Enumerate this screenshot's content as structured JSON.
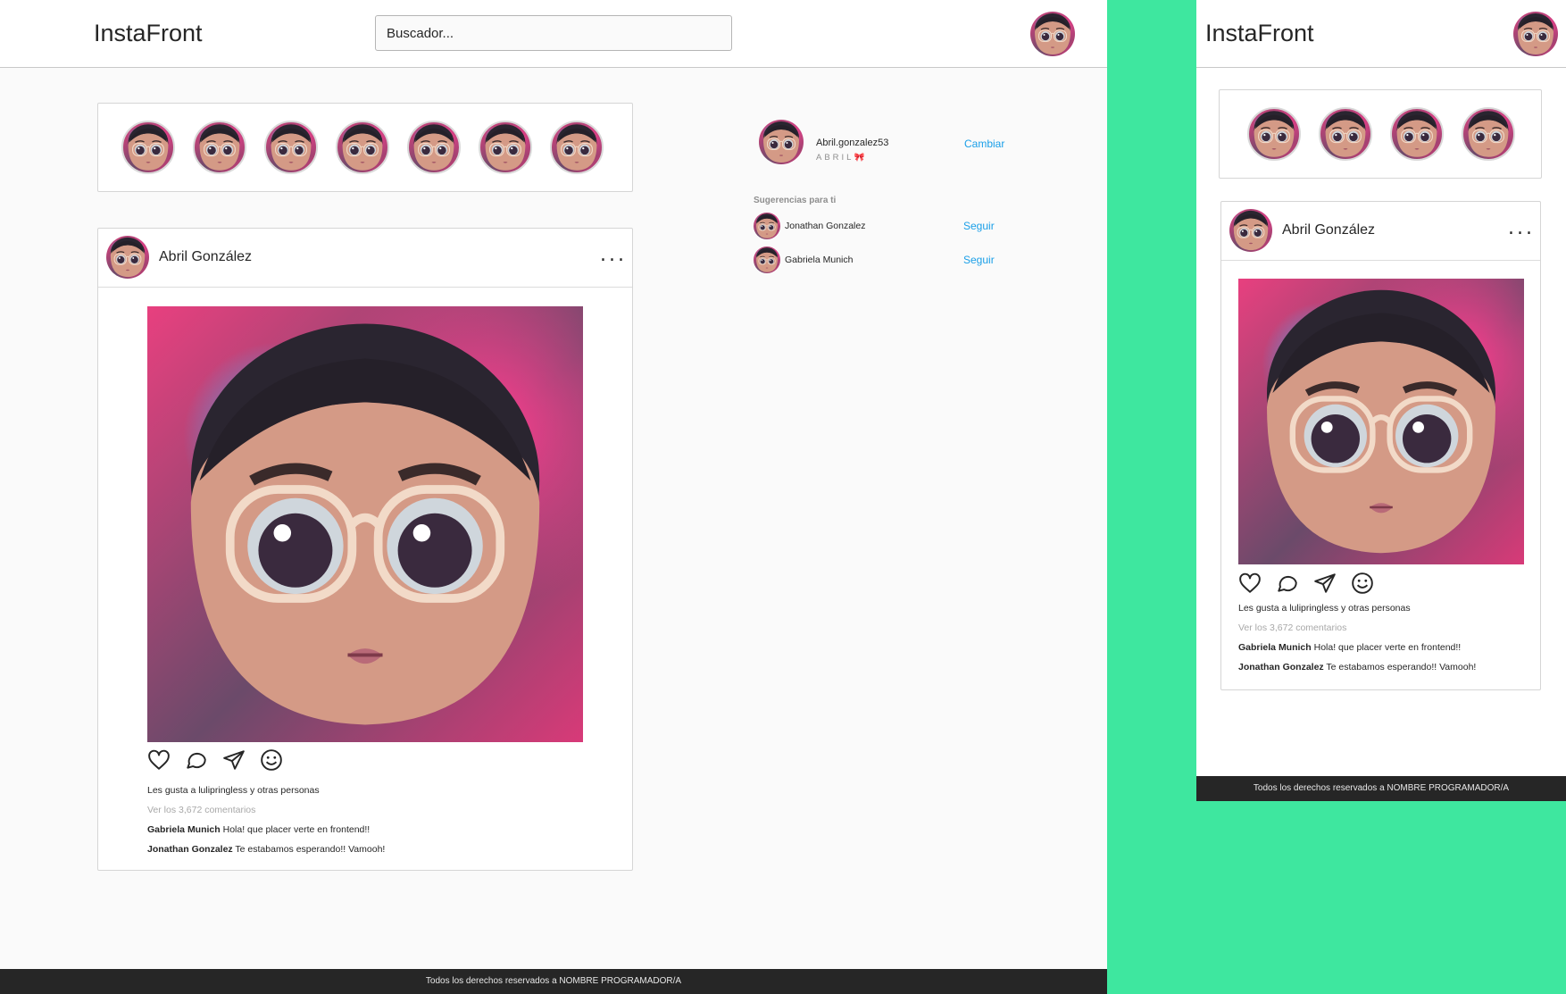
{
  "app": {
    "title": "InstaFront"
  },
  "search": {
    "placeholder": "Buscador..."
  },
  "stories": {
    "count_desktop": 7,
    "count_mobile": 4
  },
  "post": {
    "author": "Abril González",
    "more_label": "...",
    "likes_text": "Les gusta a lulipringless y otras personas",
    "view_comments": "Ver los 3,672 comentarios",
    "comments": [
      {
        "user": "Gabriela Munich",
        "text": "Hola! que placer verte en frontend!!"
      },
      {
        "user": "Jonathan Gonzalez",
        "text": "Te estabamos esperando!! Vamooh!"
      }
    ]
  },
  "sidebar": {
    "username": "Abril.gonzalez53",
    "subtitle": "ABRIL🎀",
    "switch_label": "Cambiar",
    "suggestions_title": "Sugerencias para ti",
    "suggestions": [
      {
        "name": "Jonathan Gonzalez",
        "action": "Seguir"
      },
      {
        "name": "Gabriela Munich",
        "action": "Seguir"
      }
    ]
  },
  "footer": {
    "text": "Todos los derechos reservados a NOMBRE PROGRAMADOR/A"
  },
  "colors": {
    "accent": "#1a9fe8",
    "footer_bg": "#262626",
    "outer_bg": "#3ee79f",
    "page_bg": "#fafafa"
  },
  "icons": [
    "heart-icon",
    "comment-icon",
    "send-icon",
    "emoji-icon",
    "more-dots-icon"
  ]
}
